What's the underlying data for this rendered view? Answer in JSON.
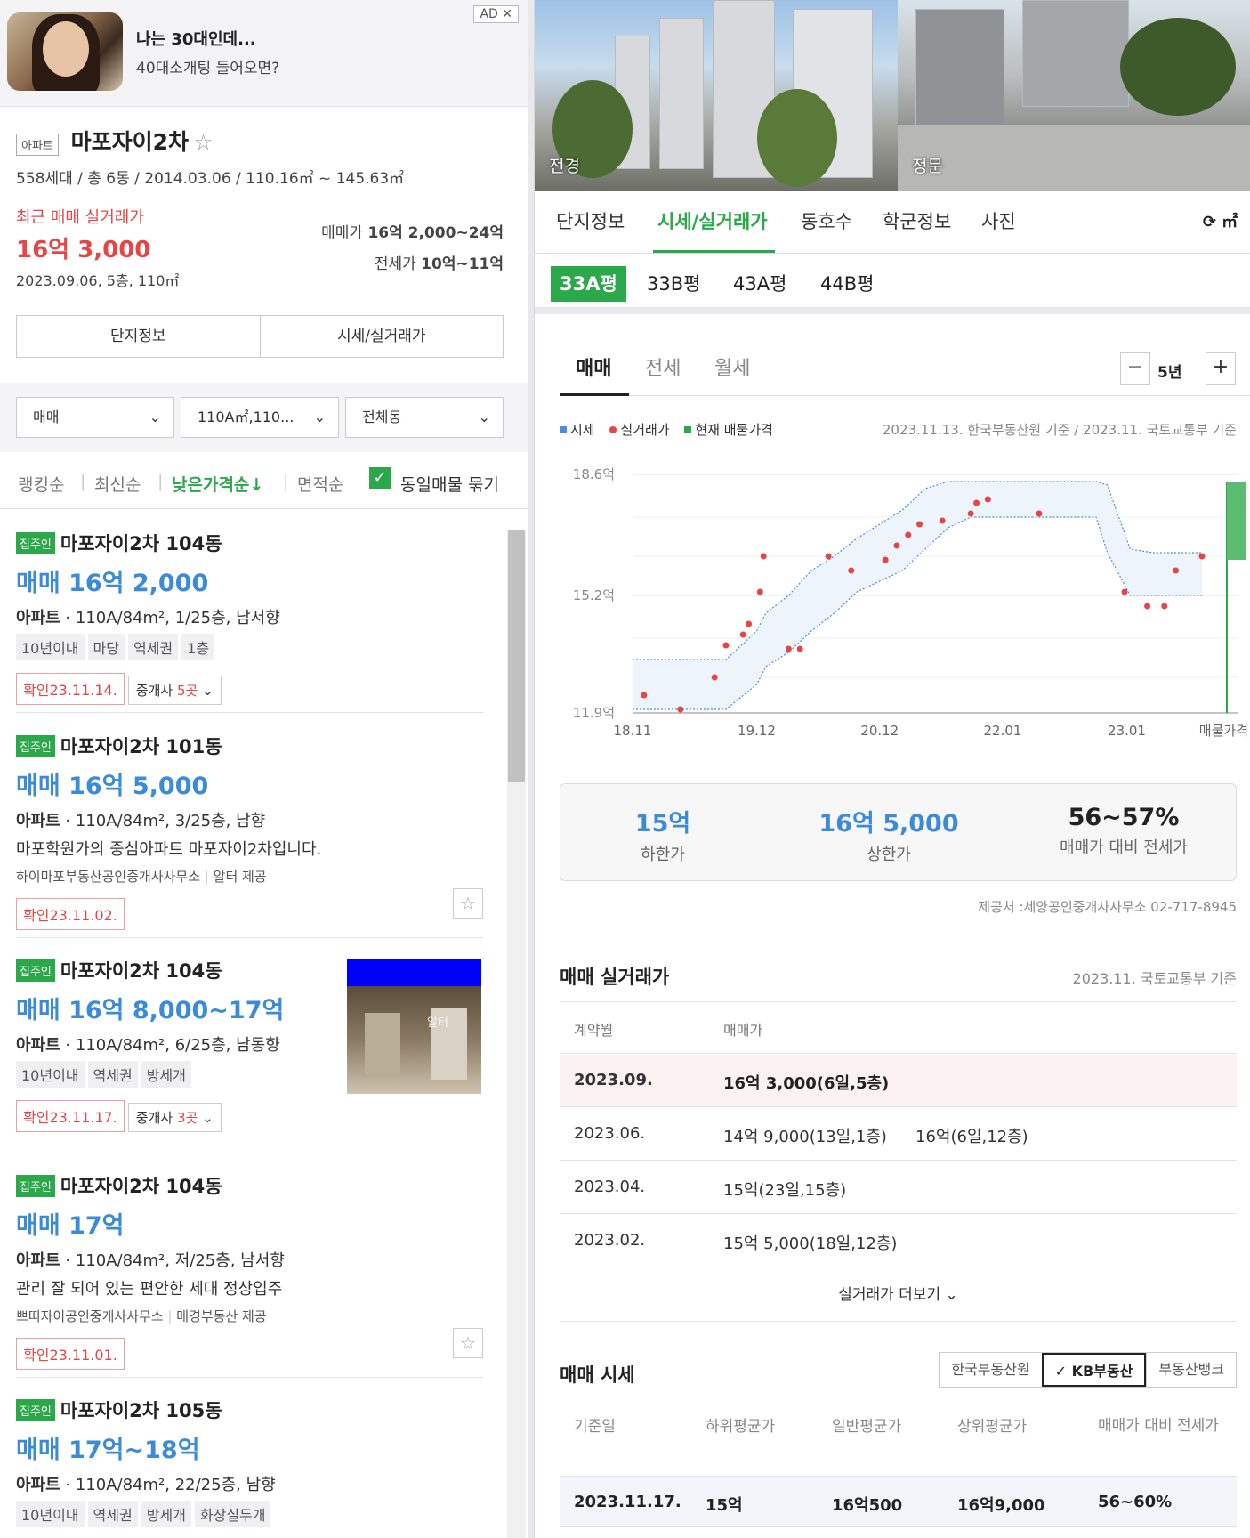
{
  "ad": {
    "badge": "AD ✕",
    "line1": "나는 30대인데...",
    "line2": "40대소개팅 들어오면?"
  },
  "complex": {
    "type_tag": "아파트",
    "name": "마포자이2차",
    "star": "☆",
    "info": "558세대 / 총 6동 / 2014.03.06 / 110.16㎡ ~ 145.63㎡",
    "recent_label": "최근 매매 실거래가",
    "recent_price": "16억 3,000",
    "recent_detail": "2023.09.06, 5층, 110㎡",
    "sale_label": "매매가",
    "sale_value": "16억 2,000~24억",
    "jeonse_label": "전세가",
    "jeonse_value": "10억~11억",
    "buttons": [
      "단지정보",
      "시세/실거래가"
    ]
  },
  "filters": {
    "trade": "매매",
    "area": "110A㎡,110...",
    "dong": "전체동",
    "chev": "⌄"
  },
  "sorts": {
    "rank": "랭킹순",
    "latest": "최신순",
    "low": "낮은가격순↓",
    "area": "면적순",
    "group": "동일매물 묶기",
    "sep": "|",
    "check": "✓"
  },
  "listings": [
    {
      "owner": "집주인",
      "name": "마포자이2차 104동",
      "price": "매매 16억 2,000",
      "type": "아파트",
      "spec": "110A/84m², 1/25층, 남서향",
      "chips": [
        "10년이내",
        "마당",
        "역세권",
        "1층"
      ],
      "confirm": "확인23.11.14.",
      "agent_label": "중개사",
      "agent_count": "5곳"
    },
    {
      "owner": "집주인",
      "name": "마포자이2차 101동",
      "price": "매매 16억 5,000",
      "type": "아파트",
      "spec": "110A/84m², 3/25층, 남향",
      "desc": "마포학원가의 중심아파트 마포자이2차입니다.",
      "src1": "하이마포부동산공인중개사사무소",
      "src2": "알터 제공",
      "confirm": "확인23.11.02.",
      "star": "☆"
    },
    {
      "owner": "집주인",
      "name": "마포자이2차 104동",
      "price": "매매 16억 8,000~17억",
      "type": "아파트",
      "spec": "110A/84m², 6/25층, 남동향",
      "chips": [
        "10년이내",
        "역세권",
        "방세개"
      ],
      "confirm": "확인23.11.17.",
      "agent_label": "중개사",
      "agent_count": "3곳",
      "thumb_logo": "알터"
    },
    {
      "owner": "집주인",
      "name": "마포자이2차 104동",
      "price": "매매 17억",
      "type": "아파트",
      "spec": "110A/84m², 저/25층, 남서향",
      "desc": "관리 잘 되어 있는 편안한 세대 정상입주",
      "src1": "쁘띠자이공인중개사사무소",
      "src2": "매경부동산 제공",
      "confirm": "확인23.11.01.",
      "star": "☆"
    },
    {
      "owner": "집주인",
      "name": "마포자이2차 105동",
      "price": "매매 17억~18억",
      "type": "아파트",
      "spec": "110A/84m², 22/25층, 남향",
      "chips": [
        "10년이내",
        "역세권",
        "방세개",
        "화장실두개"
      ]
    }
  ],
  "photos": {
    "p1": "전경",
    "p2": "정문"
  },
  "tabs": {
    "items": [
      "단지정보",
      "시세/실거래가",
      "동호수",
      "학군정보",
      "사진"
    ],
    "unit": "⟳ ㎡"
  },
  "pyeong": [
    "33A평",
    "33B평",
    "43A평",
    "44B평"
  ],
  "trade_tabs": {
    "items": [
      "매매",
      "전세",
      "월세"
    ],
    "period": "5년",
    "minus": "−",
    "plus": "+"
  },
  "legend": {
    "market": "시세",
    "actual": "실거래가",
    "listing": "현재 매물가격",
    "basis": "2023.11.13. 한국부동산원 기준 / 2023.11. 국토교통부 기준",
    "colors": {
      "market": "#4a90d9",
      "actual": "#e64545",
      "listing": "#2aa84a"
    }
  },
  "chart_data": {
    "type": "line",
    "y_ticks": [
      "18.6억",
      "15.2억",
      "11.9억"
    ],
    "x_ticks": [
      "18.11",
      "19.12",
      "20.12",
      "22.01",
      "23.01",
      "매물가격"
    ],
    "ylim": [
      11.9,
      18.6
    ],
    "x": [
      2018.83,
      2019.0,
      2019.3,
      2019.5,
      2019.65,
      2019.92,
      2020.0,
      2020.2,
      2020.4,
      2020.6,
      2020.8,
      2021.0,
      2021.2,
      2021.4,
      2021.6,
      2021.8,
      2022.0,
      2022.2,
      2022.4,
      2022.6,
      2022.75,
      2022.9,
      2023.0,
      2023.2,
      2023.4,
      2023.6,
      2023.83
    ],
    "series": [
      {
        "name": "시세",
        "lower": [
          12.0,
          12.0,
          12.0,
          12.0,
          12.0,
          12.7,
          13.2,
          13.6,
          14.2,
          14.7,
          15.3,
          15.6,
          15.9,
          16.5,
          17.1,
          17.4,
          17.4,
          17.4,
          17.4,
          17.4,
          17.4,
          17.4,
          16.4,
          15.2,
          15.2,
          15.2,
          15.2
        ],
        "upper": [
          13.4,
          13.4,
          13.4,
          13.4,
          13.4,
          14.2,
          14.7,
          15.2,
          15.9,
          16.3,
          16.8,
          17.2,
          17.6,
          18.2,
          18.4,
          18.4,
          18.4,
          18.4,
          18.4,
          18.4,
          18.4,
          18.4,
          18.3,
          16.5,
          16.4,
          16.4,
          16.4
        ]
      },
      {
        "name": "실거래가",
        "points": [
          [
            2018.93,
            12.4
          ],
          [
            2019.25,
            12.0
          ],
          [
            2019.55,
            12.9
          ],
          [
            2019.65,
            13.8
          ],
          [
            2019.8,
            14.1
          ],
          [
            2019.85,
            14.4
          ],
          [
            2019.95,
            15.3
          ],
          [
            2019.98,
            16.3
          ],
          [
            2020.2,
            13.7
          ],
          [
            2020.3,
            13.7
          ],
          [
            2020.55,
            16.3
          ],
          [
            2020.75,
            15.9
          ],
          [
            2021.05,
            16.2
          ],
          [
            2021.15,
            16.6
          ],
          [
            2021.25,
            16.9
          ],
          [
            2021.35,
            17.2
          ],
          [
            2021.55,
            17.3
          ],
          [
            2021.8,
            17.5
          ],
          [
            2021.85,
            17.8
          ],
          [
            2021.95,
            17.9
          ],
          [
            2022.4,
            17.5
          ],
          [
            2023.15,
            15.3
          ],
          [
            2023.35,
            14.9
          ],
          [
            2023.5,
            14.9
          ],
          [
            2023.6,
            15.9
          ],
          [
            2023.83,
            16.3
          ]
        ]
      },
      {
        "name": "현재 매물가격",
        "range": [
          16.2,
          18.4
        ]
      }
    ]
  },
  "summary": {
    "low_value": "15억",
    "low_label": "하한가",
    "high_value": "16억 5,000",
    "high_label": "상한가",
    "ratio_value": "56~57%",
    "ratio_label": "매매가 대비 전세가",
    "provider": "제공처 :세양공인중개사사무소 02-717-8945"
  },
  "actual": {
    "title": "매매 실거래가",
    "basis": "2023.11. 국토교통부 기준",
    "headers": [
      "계약월",
      "매매가"
    ],
    "rows": [
      {
        "month": "2023.09.",
        "deals": [
          "16억 3,000(6일,5층)"
        ]
      },
      {
        "month": "2023.06.",
        "deals": [
          "14억 9,000(13일,1층)",
          "16억(6일,12층)"
        ]
      },
      {
        "month": "2023.04.",
        "deals": [
          "15억(23일,15층)"
        ]
      },
      {
        "month": "2023.02.",
        "deals": [
          "15억 5,000(18일,12층)"
        ]
      }
    ],
    "more": "실거래가 더보기 ⌄"
  },
  "market": {
    "title": "매매 시세",
    "sources": [
      "한국부동산원",
      "✓ KB부동산",
      "부동산뱅크"
    ],
    "headers": [
      "기준일",
      "하위평균가",
      "일반평균가",
      "상위평균가",
      "매매가 대비 전세가"
    ],
    "row": [
      "2023.11.17.",
      "15억",
      "16억500",
      "16억9,000",
      "56~60%"
    ]
  }
}
